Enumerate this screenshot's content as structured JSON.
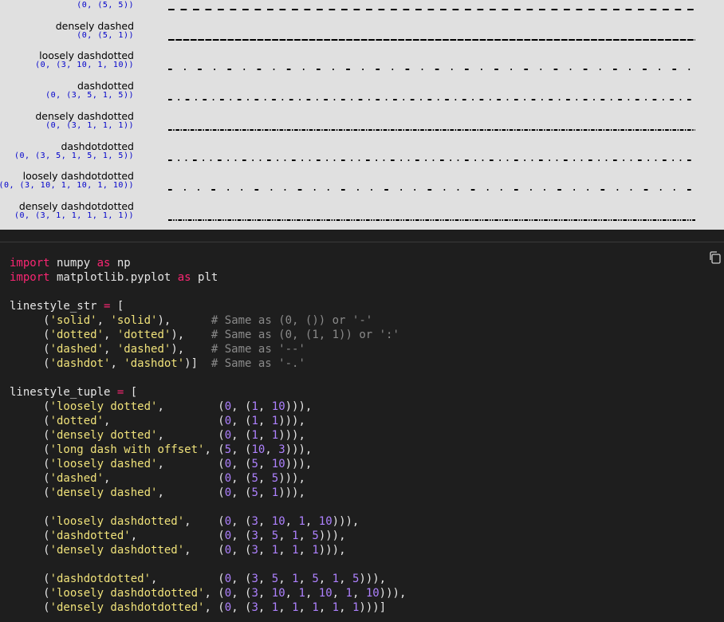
{
  "figure": {
    "rows": [
      {
        "name": "",
        "tuple": "(0, (5, 5))",
        "dash": [
          5,
          5
        ]
      },
      {
        "name": "densely dashed",
        "tuple": "(0, (5, 1))",
        "dash": [
          5,
          1
        ]
      },
      {
        "name": "loosely dashdotted",
        "tuple": "(0, (3, 10, 1, 10))",
        "dash": [
          3,
          10,
          1,
          10
        ]
      },
      {
        "name": "dashdotted",
        "tuple": "(0, (3, 5, 1, 5))",
        "dash": [
          3,
          5,
          1,
          5
        ]
      },
      {
        "name": "densely dashdotted",
        "tuple": "(0, (3, 1, 1, 1))",
        "dash": [
          3,
          1,
          1,
          1
        ]
      },
      {
        "name": "dashdotdotted",
        "tuple": "(0, (3, 5, 1, 5, 1, 5))",
        "dash": [
          3,
          5,
          1,
          5,
          1,
          5
        ]
      },
      {
        "name": "loosely dashdotdotted",
        "tuple": "(0, (3, 10, 1, 10, 1, 10))",
        "dash": [
          3,
          10,
          1,
          10,
          1,
          10
        ]
      },
      {
        "name": "densely dashdotdotted",
        "tuple": "(0, (3, 1, 1, 1, 1, 1))",
        "dash": [
          3,
          1,
          1,
          1,
          1,
          1
        ]
      }
    ]
  },
  "code": {
    "copy_icon": "copy-icon",
    "lines": [
      [
        {
          "t": "kw",
          "v": "import"
        },
        {
          "t": "",
          "v": " numpy "
        },
        {
          "t": "kw",
          "v": "as"
        },
        {
          "t": "",
          "v": " np"
        }
      ],
      [
        {
          "t": "kw",
          "v": "import"
        },
        {
          "t": "",
          "v": " matplotlib.pyplot "
        },
        {
          "t": "kw",
          "v": "as"
        },
        {
          "t": "",
          "v": " plt"
        }
      ],
      [],
      [
        {
          "t": "",
          "v": "linestyle_str "
        },
        {
          "t": "op",
          "v": "="
        },
        {
          "t": "",
          "v": " ["
        }
      ],
      [
        {
          "t": "",
          "v": "     ("
        },
        {
          "t": "st",
          "v": "'solid'"
        },
        {
          "t": "",
          "v": ", "
        },
        {
          "t": "st",
          "v": "'solid'"
        },
        {
          "t": "",
          "v": "),      "
        },
        {
          "t": "cm",
          "v": "# Same as (0, ()) or '-'"
        }
      ],
      [
        {
          "t": "",
          "v": "     ("
        },
        {
          "t": "st",
          "v": "'dotted'"
        },
        {
          "t": "",
          "v": ", "
        },
        {
          "t": "st",
          "v": "'dotted'"
        },
        {
          "t": "",
          "v": "),    "
        },
        {
          "t": "cm",
          "v": "# Same as (0, (1, 1)) or ':'"
        }
      ],
      [
        {
          "t": "",
          "v": "     ("
        },
        {
          "t": "st",
          "v": "'dashed'"
        },
        {
          "t": "",
          "v": ", "
        },
        {
          "t": "st",
          "v": "'dashed'"
        },
        {
          "t": "",
          "v": "),    "
        },
        {
          "t": "cm",
          "v": "# Same as '--'"
        }
      ],
      [
        {
          "t": "",
          "v": "     ("
        },
        {
          "t": "st",
          "v": "'dashdot'"
        },
        {
          "t": "",
          "v": ", "
        },
        {
          "t": "st",
          "v": "'dashdot'"
        },
        {
          "t": "",
          "v": ")]  "
        },
        {
          "t": "cm",
          "v": "# Same as '-.'"
        }
      ],
      [],
      [
        {
          "t": "",
          "v": "linestyle_tuple "
        },
        {
          "t": "op",
          "v": "="
        },
        {
          "t": "",
          "v": " ["
        }
      ],
      [
        {
          "t": "",
          "v": "     ("
        },
        {
          "t": "st",
          "v": "'loosely dotted'"
        },
        {
          "t": "",
          "v": ",        ("
        },
        {
          "t": "nm",
          "v": "0"
        },
        {
          "t": "",
          "v": ", ("
        },
        {
          "t": "nm",
          "v": "1"
        },
        {
          "t": "",
          "v": ", "
        },
        {
          "t": "nm",
          "v": "10"
        },
        {
          "t": "",
          "v": "))),"
        }
      ],
      [
        {
          "t": "",
          "v": "     ("
        },
        {
          "t": "st",
          "v": "'dotted'"
        },
        {
          "t": "",
          "v": ",                ("
        },
        {
          "t": "nm",
          "v": "0"
        },
        {
          "t": "",
          "v": ", ("
        },
        {
          "t": "nm",
          "v": "1"
        },
        {
          "t": "",
          "v": ", "
        },
        {
          "t": "nm",
          "v": "1"
        },
        {
          "t": "",
          "v": "))),"
        }
      ],
      [
        {
          "t": "",
          "v": "     ("
        },
        {
          "t": "st",
          "v": "'densely dotted'"
        },
        {
          "t": "",
          "v": ",        ("
        },
        {
          "t": "nm",
          "v": "0"
        },
        {
          "t": "",
          "v": ", ("
        },
        {
          "t": "nm",
          "v": "1"
        },
        {
          "t": "",
          "v": ", "
        },
        {
          "t": "nm",
          "v": "1"
        },
        {
          "t": "",
          "v": "))),"
        }
      ],
      [
        {
          "t": "",
          "v": "     ("
        },
        {
          "t": "st",
          "v": "'long dash with offset'"
        },
        {
          "t": "",
          "v": ", ("
        },
        {
          "t": "nm",
          "v": "5"
        },
        {
          "t": "",
          "v": ", ("
        },
        {
          "t": "nm",
          "v": "10"
        },
        {
          "t": "",
          "v": ", "
        },
        {
          "t": "nm",
          "v": "3"
        },
        {
          "t": "",
          "v": "))),"
        }
      ],
      [
        {
          "t": "",
          "v": "     ("
        },
        {
          "t": "st",
          "v": "'loosely dashed'"
        },
        {
          "t": "",
          "v": ",        ("
        },
        {
          "t": "nm",
          "v": "0"
        },
        {
          "t": "",
          "v": ", ("
        },
        {
          "t": "nm",
          "v": "5"
        },
        {
          "t": "",
          "v": ", "
        },
        {
          "t": "nm",
          "v": "10"
        },
        {
          "t": "",
          "v": "))),"
        }
      ],
      [
        {
          "t": "",
          "v": "     ("
        },
        {
          "t": "st",
          "v": "'dashed'"
        },
        {
          "t": "",
          "v": ",                ("
        },
        {
          "t": "nm",
          "v": "0"
        },
        {
          "t": "",
          "v": ", ("
        },
        {
          "t": "nm",
          "v": "5"
        },
        {
          "t": "",
          "v": ", "
        },
        {
          "t": "nm",
          "v": "5"
        },
        {
          "t": "",
          "v": "))),"
        }
      ],
      [
        {
          "t": "",
          "v": "     ("
        },
        {
          "t": "st",
          "v": "'densely dashed'"
        },
        {
          "t": "",
          "v": ",        ("
        },
        {
          "t": "nm",
          "v": "0"
        },
        {
          "t": "",
          "v": ", ("
        },
        {
          "t": "nm",
          "v": "5"
        },
        {
          "t": "",
          "v": ", "
        },
        {
          "t": "nm",
          "v": "1"
        },
        {
          "t": "",
          "v": "))),"
        }
      ],
      [],
      [
        {
          "t": "",
          "v": "     ("
        },
        {
          "t": "st",
          "v": "'loosely dashdotted'"
        },
        {
          "t": "",
          "v": ",    ("
        },
        {
          "t": "nm",
          "v": "0"
        },
        {
          "t": "",
          "v": ", ("
        },
        {
          "t": "nm",
          "v": "3"
        },
        {
          "t": "",
          "v": ", "
        },
        {
          "t": "nm",
          "v": "10"
        },
        {
          "t": "",
          "v": ", "
        },
        {
          "t": "nm",
          "v": "1"
        },
        {
          "t": "",
          "v": ", "
        },
        {
          "t": "nm",
          "v": "10"
        },
        {
          "t": "",
          "v": "))),"
        }
      ],
      [
        {
          "t": "",
          "v": "     ("
        },
        {
          "t": "st",
          "v": "'dashdotted'"
        },
        {
          "t": "",
          "v": ",            ("
        },
        {
          "t": "nm",
          "v": "0"
        },
        {
          "t": "",
          "v": ", ("
        },
        {
          "t": "nm",
          "v": "3"
        },
        {
          "t": "",
          "v": ", "
        },
        {
          "t": "nm",
          "v": "5"
        },
        {
          "t": "",
          "v": ", "
        },
        {
          "t": "nm",
          "v": "1"
        },
        {
          "t": "",
          "v": ", "
        },
        {
          "t": "nm",
          "v": "5"
        },
        {
          "t": "",
          "v": "))),"
        }
      ],
      [
        {
          "t": "",
          "v": "     ("
        },
        {
          "t": "st",
          "v": "'densely dashdotted'"
        },
        {
          "t": "",
          "v": ",    ("
        },
        {
          "t": "nm",
          "v": "0"
        },
        {
          "t": "",
          "v": ", ("
        },
        {
          "t": "nm",
          "v": "3"
        },
        {
          "t": "",
          "v": ", "
        },
        {
          "t": "nm",
          "v": "1"
        },
        {
          "t": "",
          "v": ", "
        },
        {
          "t": "nm",
          "v": "1"
        },
        {
          "t": "",
          "v": ", "
        },
        {
          "t": "nm",
          "v": "1"
        },
        {
          "t": "",
          "v": "))),"
        }
      ],
      [],
      [
        {
          "t": "",
          "v": "     ("
        },
        {
          "t": "st",
          "v": "'dashdotdotted'"
        },
        {
          "t": "",
          "v": ",         ("
        },
        {
          "t": "nm",
          "v": "0"
        },
        {
          "t": "",
          "v": ", ("
        },
        {
          "t": "nm",
          "v": "3"
        },
        {
          "t": "",
          "v": ", "
        },
        {
          "t": "nm",
          "v": "5"
        },
        {
          "t": "",
          "v": ", "
        },
        {
          "t": "nm",
          "v": "1"
        },
        {
          "t": "",
          "v": ", "
        },
        {
          "t": "nm",
          "v": "5"
        },
        {
          "t": "",
          "v": ", "
        },
        {
          "t": "nm",
          "v": "1"
        },
        {
          "t": "",
          "v": ", "
        },
        {
          "t": "nm",
          "v": "5"
        },
        {
          "t": "",
          "v": "))),"
        }
      ],
      [
        {
          "t": "",
          "v": "     ("
        },
        {
          "t": "st",
          "v": "'loosely dashdotdotted'"
        },
        {
          "t": "",
          "v": ", ("
        },
        {
          "t": "nm",
          "v": "0"
        },
        {
          "t": "",
          "v": ", ("
        },
        {
          "t": "nm",
          "v": "3"
        },
        {
          "t": "",
          "v": ", "
        },
        {
          "t": "nm",
          "v": "10"
        },
        {
          "t": "",
          "v": ", "
        },
        {
          "t": "nm",
          "v": "1"
        },
        {
          "t": "",
          "v": ", "
        },
        {
          "t": "nm",
          "v": "10"
        },
        {
          "t": "",
          "v": ", "
        },
        {
          "t": "nm",
          "v": "1"
        },
        {
          "t": "",
          "v": ", "
        },
        {
          "t": "nm",
          "v": "10"
        },
        {
          "t": "",
          "v": "))),"
        }
      ],
      [
        {
          "t": "",
          "v": "     ("
        },
        {
          "t": "st",
          "v": "'densely dashdotdotted'"
        },
        {
          "t": "",
          "v": ", ("
        },
        {
          "t": "nm",
          "v": "0"
        },
        {
          "t": "",
          "v": ", ("
        },
        {
          "t": "nm",
          "v": "3"
        },
        {
          "t": "",
          "v": ", "
        },
        {
          "t": "nm",
          "v": "1"
        },
        {
          "t": "",
          "v": ", "
        },
        {
          "t": "nm",
          "v": "1"
        },
        {
          "t": "",
          "v": ", "
        },
        {
          "t": "nm",
          "v": "1"
        },
        {
          "t": "",
          "v": ", "
        },
        {
          "t": "nm",
          "v": "1"
        },
        {
          "t": "",
          "v": ", "
        },
        {
          "t": "nm",
          "v": "1"
        },
        {
          "t": "",
          "v": ")))]"
        }
      ]
    ]
  }
}
